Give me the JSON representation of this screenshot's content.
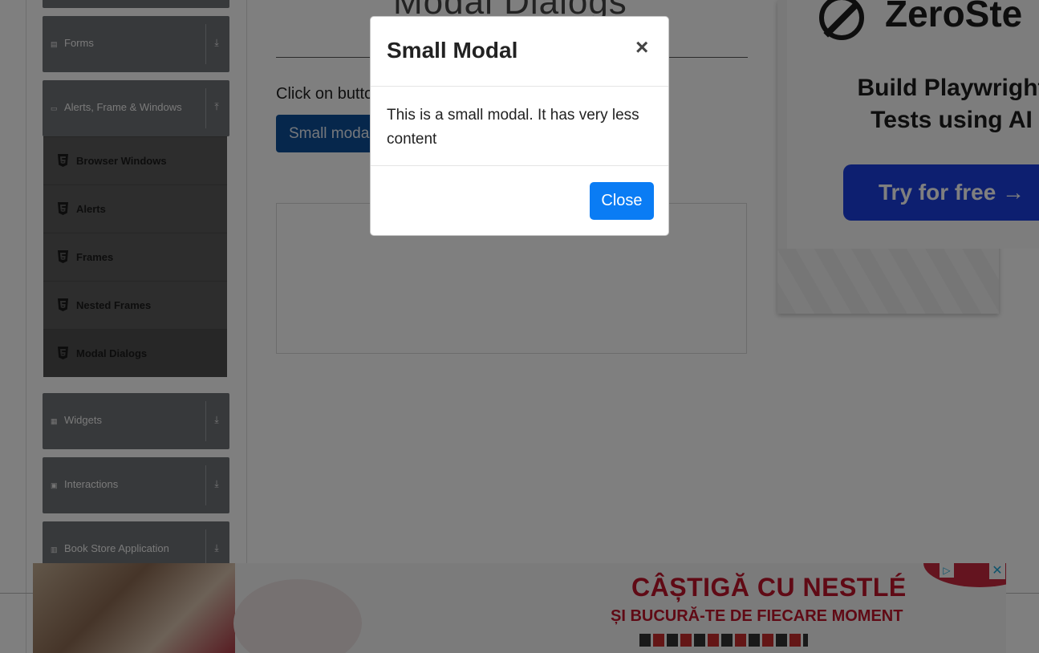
{
  "page": {
    "title": "Modal Dialogs",
    "instruction": "Click on button to see modal",
    "small_modal_button": "Small modal"
  },
  "sidebar": {
    "groups_top": [
      {
        "label": "Forms",
        "icon": "form-icon",
        "arrow": "⤓"
      },
      {
        "label": "Alerts, Frame & Windows",
        "icon": "window-icon",
        "arrow": "⤒"
      }
    ],
    "items": [
      {
        "label": "Browser Windows",
        "icon": "html5-icon"
      },
      {
        "label": "Alerts",
        "icon": "html5-icon"
      },
      {
        "label": "Frames",
        "icon": "html5-icon"
      },
      {
        "label": "Nested Frames",
        "icon": "html5-icon"
      },
      {
        "label": "Modal Dialogs",
        "icon": "html5-icon",
        "active": true
      }
    ],
    "groups_bottom": [
      {
        "label": "Widgets",
        "icon": "grid-icon",
        "arrow": "⤓"
      },
      {
        "label": "Interactions",
        "icon": "interaction-icon",
        "arrow": "⤓"
      },
      {
        "label": "Book Store Application",
        "icon": "book-icon",
        "arrow": "⤓"
      }
    ]
  },
  "modal": {
    "title": "Small Modal",
    "close_symbol": "×",
    "body": "This is a small modal. It has very less content",
    "close_button": "Close"
  },
  "right_ad": {
    "brand": "ZeroSte",
    "headline": "Build Playwright Tests using AI",
    "cta": "Try for free →"
  },
  "bottom_ad": {
    "headline1": "CÂȘTIGĂ CU NESTLÉ",
    "headline2": "ȘI BUCURĂ-TE DE FIECARE MOMENT",
    "adchoices_symbol": "▷",
    "close_symbol": "✕"
  },
  "colors": {
    "primary": "#0a7cf4",
    "sidebar_group": "#6f7276",
    "ad_cta": "#1a3fe0",
    "ad_red": "#c0142a"
  }
}
